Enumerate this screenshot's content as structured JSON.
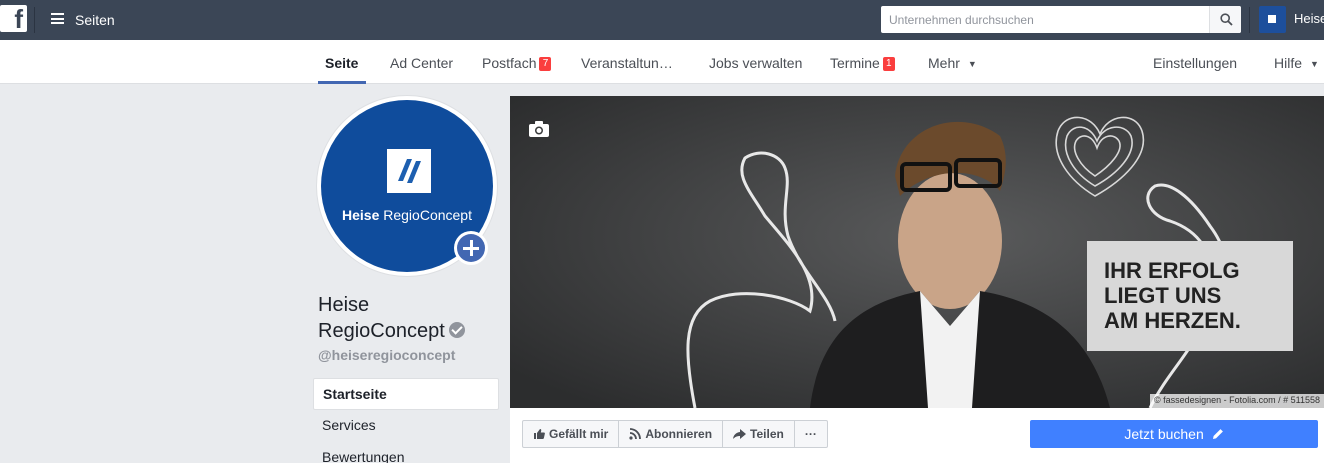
{
  "topbar": {
    "menu_label": "Seiten",
    "search_placeholder": "Unternehmen durchsuchen",
    "account_name": "Heise"
  },
  "nav": {
    "tabs": [
      {
        "label": "Seite"
      },
      {
        "label": "Ad Center"
      },
      {
        "label": "Postfach",
        "badge": "7"
      },
      {
        "label": "Veranstaltun…"
      },
      {
        "label": "Jobs verwalten"
      },
      {
        "label": "Termine",
        "badge": "1"
      },
      {
        "label": "Mehr"
      }
    ],
    "right": [
      {
        "label": "Einstellungen"
      },
      {
        "label": "Hilfe"
      }
    ]
  },
  "profile": {
    "logo_brand": "Heise",
    "logo_product": "RegioConcept",
    "name_line1": "Heise",
    "name_line2": "RegioConcept",
    "handle": "@heiseregioconcept"
  },
  "sidebar": {
    "items": [
      {
        "label": "Startseite"
      },
      {
        "label": "Services"
      },
      {
        "label": "Bewertungen"
      }
    ]
  },
  "cover": {
    "slogan": [
      "IHR ERFOLG",
      "LIEGT UNS",
      "AM HERZEN."
    ],
    "credit": "© fassedesignen - Fotolia.com / # 511558"
  },
  "actions": {
    "like": "Gefällt mir",
    "follow": "Abonnieren",
    "share": "Teilen",
    "more": "···",
    "cta": "Jetzt buchen"
  },
  "colors": {
    "topbar": "#3b4656",
    "accent": "#4267b2",
    "cta": "#4080ff",
    "badge": "#fa3e3e",
    "logo_blue": "#0f4c9c"
  }
}
